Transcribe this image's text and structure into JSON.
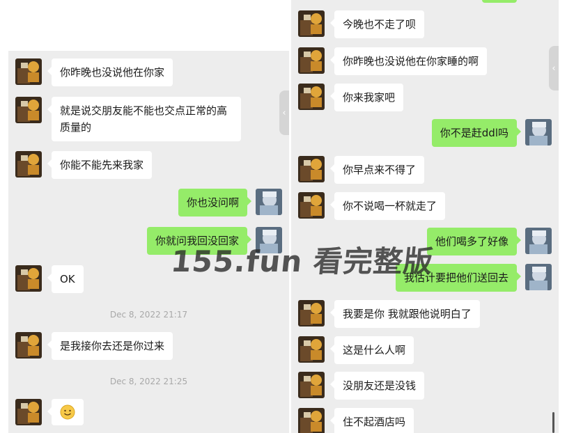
{
  "watermark": "155.fun 看完整版",
  "left_chat": {
    "messages": [
      {
        "side": "in",
        "text": "你昨晚也没说他在你家"
      },
      {
        "side": "in",
        "text": "就是说交朋友能不能也交点正常的高质量的"
      },
      {
        "side": "in",
        "text": "你能不能先来我家"
      },
      {
        "side": "out",
        "text": "你也没问啊"
      },
      {
        "side": "out",
        "text": "你就问我回没回家"
      },
      {
        "side": "in",
        "text": "OK"
      },
      {
        "side": "in",
        "text": "是我接你去还是你过来"
      },
      {
        "side": "in",
        "emoji": "smile-emoji-icon"
      }
    ],
    "timestamps": [
      "Dec 8, 2022 21:17",
      "Dec 8, 2022 21:25"
    ]
  },
  "right_chat": {
    "messages": [
      {
        "side": "in",
        "text": "今晚也不走了呗"
      },
      {
        "side": "in",
        "text": "你昨晚也没说他在你家睡的啊"
      },
      {
        "side": "in",
        "text": "你来我家吧"
      },
      {
        "side": "out",
        "text": "你不是赶ddl吗"
      },
      {
        "side": "in",
        "text": "你早点来不得了"
      },
      {
        "side": "in",
        "text": "你不说喝一杯就走了"
      },
      {
        "side": "out",
        "text": "他们喝多了好像"
      },
      {
        "side": "out",
        "text": "我估计要把他们送回去"
      },
      {
        "side": "in",
        "text": "我要是你 我就跟他说明白了"
      },
      {
        "side": "in",
        "text": "这是什么人啊"
      },
      {
        "side": "in",
        "text": "没朋友还是没钱"
      },
      {
        "side": "in",
        "text": "住不起酒店吗"
      }
    ]
  },
  "colors": {
    "outgoing_bubble": "#95ec69",
    "incoming_bubble": "#ffffff",
    "chat_background": "#ededed"
  }
}
